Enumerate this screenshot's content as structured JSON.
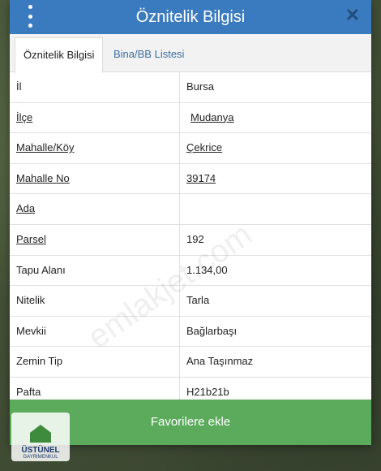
{
  "header": {
    "title": "Öznitelik Bilgisi",
    "close_label": "✕"
  },
  "tabs": [
    {
      "label": "Öznitelik Bilgisi"
    },
    {
      "label": "Bina/BB Listesi"
    }
  ],
  "rows": [
    {
      "key": "İl",
      "value": "Bursa"
    },
    {
      "key": "İlçe",
      "value": "Mudanya"
    },
    {
      "key": "Mahalle/Köy",
      "value": "Çekrice"
    },
    {
      "key": "Mahalle No",
      "value": "39174"
    },
    {
      "key": "Ada",
      "value": ""
    },
    {
      "key": "Parsel",
      "value": "192"
    },
    {
      "key": "Tapu Alanı",
      "value": "1.134,00"
    },
    {
      "key": "Nitelik",
      "value": "Tarla"
    },
    {
      "key": "Mevkii",
      "value": "Bağlarbaşı"
    },
    {
      "key": "Zemin Tip",
      "value": "Ana Taşınmaz"
    },
    {
      "key": "Pafta",
      "value": "H21b21b"
    }
  ],
  "favorite_button": {
    "label": "Favorilere ekle"
  },
  "watermark": {
    "text": "emlakjet.com"
  },
  "logo": {
    "name": "ÜSTÜNEL",
    "sub": "GAYRİMENKUL"
  },
  "colors": {
    "header": "#3a7bbf",
    "button": "#5cab5d",
    "tab_link": "#3a6fa3"
  }
}
